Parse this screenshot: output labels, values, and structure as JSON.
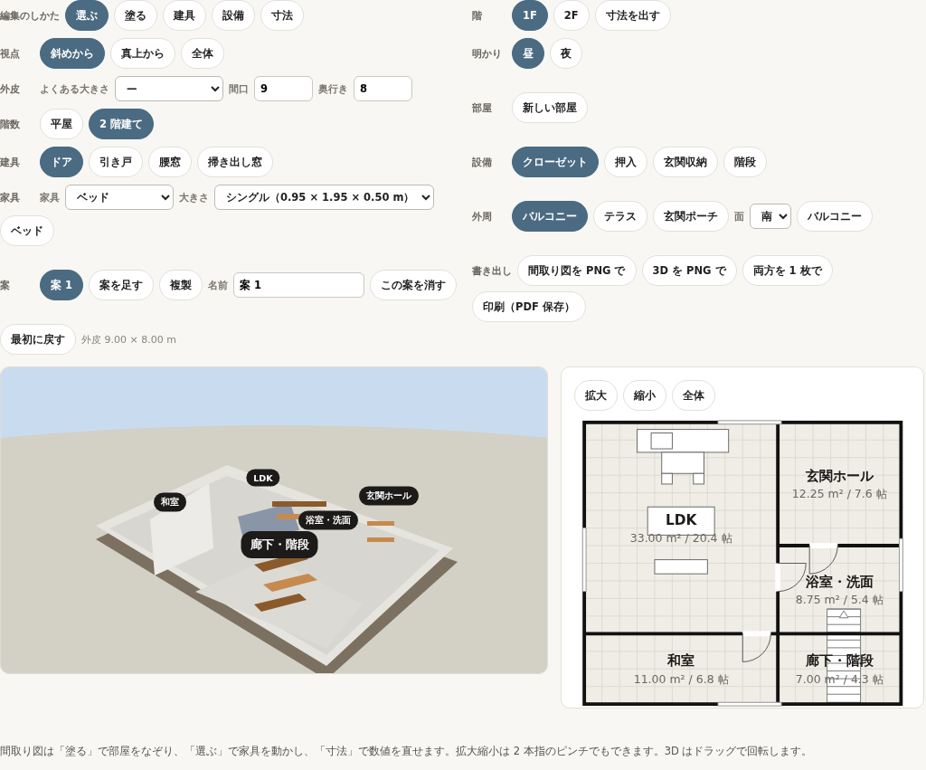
{
  "left_panel": {
    "sections": [
      {
        "rows": [
          {
            "label": "編集のしかた",
            "items": [
              {
                "kind": "toggle",
                "label": "選ぶ",
                "selected": true
              },
              {
                "kind": "toggle",
                "label": "塗る",
                "selected": false
              },
              {
                "kind": "toggle",
                "label": "建具",
                "selected": false
              },
              {
                "kind": "toggle",
                "label": "設備",
                "selected": false
              },
              {
                "kind": "toggle",
                "label": "寸法",
                "selected": false
              }
            ]
          },
          {
            "label": "視点",
            "items": [
              {
                "kind": "toggle",
                "label": "斜めから",
                "selected": true
              },
              {
                "kind": "toggle",
                "label": "真上から",
                "selected": false
              },
              {
                "kind": "action",
                "label": "全体"
              }
            ]
          },
          {
            "label": "外皮",
            "items": [
              {
                "kind": "caption",
                "text": "よくある大きさ"
              },
              {
                "kind": "select",
                "value": "—"
              },
              {
                "kind": "caption",
                "text": "間口"
              },
              {
                "kind": "number_field",
                "value": "9"
              },
              {
                "kind": "caption",
                "text": "奥行き"
              },
              {
                "kind": "number_field",
                "value": "8"
              }
            ]
          },
          {
            "label": "階数",
            "items": [
              {
                "kind": "toggle",
                "label": "平屋",
                "selected": false
              },
              {
                "kind": "toggle",
                "label": "2 階建て",
                "selected": true
              }
            ]
          },
          {
            "label": "建具",
            "items": [
              {
                "kind": "toggle",
                "label": "ドア",
                "selected": true
              },
              {
                "kind": "toggle",
                "label": "引き戸",
                "selected": false
              },
              {
                "kind": "toggle",
                "label": "腰窓",
                "selected": false
              },
              {
                "kind": "toggle",
                "label": "掃き出し窓",
                "selected": false
              }
            ]
          },
          {
            "label": "家具",
            "items": [
              {
                "kind": "caption",
                "text": "家具"
              },
              {
                "kind": "select",
                "value": "ベッド"
              },
              {
                "kind": "caption",
                "text": "大きさ"
              },
              {
                "kind": "select",
                "value": "シングル（0.95 × 1.95 × 0.50 m）"
              },
              {
                "kind": "action",
                "label": "ベッド"
              }
            ]
          }
        ]
      },
      {
        "rows": [
          {
            "label": "案",
            "items": [
              {
                "kind": "toggle",
                "label": "案 1",
                "selected": true
              },
              {
                "kind": "action",
                "label": "案を足す"
              },
              {
                "kind": "action",
                "label": "複製"
              },
              {
                "kind": "caption",
                "text": "名前"
              },
              {
                "kind": "text_field",
                "value": "案 1"
              },
              {
                "kind": "action",
                "label": "この案を消す"
              }
            ]
          }
        ]
      },
      {
        "rows": [
          {
            "items": [
              {
                "kind": "action",
                "label": "最初に戻す"
              },
              {
                "kind": "note",
                "text": "外皮 9.00 × 8.00 m"
              }
            ]
          }
        ]
      }
    ]
  },
  "right_panel": {
    "sections": [
      {
        "rows": [
          {
            "label": "階",
            "items": [
              {
                "kind": "toggle",
                "label": "1F",
                "selected": true
              },
              {
                "kind": "toggle",
                "label": "2F",
                "selected": false
              },
              {
                "kind": "action",
                "label": "寸法を出す"
              }
            ]
          },
          {
            "label": "明かり",
            "items": [
              {
                "kind": "toggle",
                "label": "昼",
                "selected": true
              },
              {
                "kind": "toggle",
                "label": "夜",
                "selected": false
              }
            ]
          }
        ]
      },
      {
        "rows": [
          {
            "label": "部屋",
            "items": [
              {
                "kind": "action",
                "label": "新しい部屋"
              }
            ]
          }
        ]
      },
      {
        "rows": [
          {
            "label": "設備",
            "items": [
              {
                "kind": "toggle",
                "label": "クローゼット",
                "selected": true
              },
              {
                "kind": "toggle",
                "label": "押入",
                "selected": false
              },
              {
                "kind": "toggle",
                "label": "玄関収納",
                "selected": false
              },
              {
                "kind": "toggle",
                "label": "階段",
                "selected": false
              }
            ]
          }
        ]
      },
      {
        "rows": [
          {
            "label": "外周",
            "items": [
              {
                "kind": "toggle",
                "label": "バルコニー",
                "selected": true
              },
              {
                "kind": "toggle",
                "label": "テラス",
                "selected": false
              },
              {
                "kind": "toggle",
                "label": "玄関ポーチ",
                "selected": false
              },
              {
                "kind": "caption",
                "text": "面"
              },
              {
                "kind": "small_select",
                "value": "南"
              },
              {
                "kind": "action",
                "label": "バルコニー"
              }
            ]
          }
        ]
      },
      {
        "rows": [
          {
            "label": "書き出し",
            "items": [
              {
                "kind": "action",
                "label": "間取り図を PNG で"
              },
              {
                "kind": "action",
                "label": "3D を PNG で"
              },
              {
                "kind": "action",
                "label": "両方を 1 枚で"
              },
              {
                "kind": "action",
                "label": "印刷（PDF 保存）"
              }
            ]
          }
        ]
      }
    ]
  },
  "view_3d": {
    "labels": [
      "和室",
      "LDK",
      "玄関ホール",
      "浴室・洗面",
      "廊下・階段"
    ]
  },
  "floor_plan": {
    "buttons": [
      "拡大",
      "縮小",
      "全体"
    ],
    "rooms": [
      {
        "name": "玄関ホール",
        "area": "12.25 m² / 7.6 帖"
      },
      {
        "name": "LDK",
        "area": "33.00 m² / 20.4 帖"
      },
      {
        "name": "浴室・洗面",
        "area": "8.75 m² / 5.4 帖"
      },
      {
        "name": "和室",
        "area": "11.00 m² / 6.8 帖"
      },
      {
        "name": "廊下・階段",
        "area": "7.00 m² / 4.3 帖"
      }
    ]
  },
  "footer": {
    "note": "間取り図は「塗る」で部屋をなぞり、「選ぶ」で家具を動かし、「寸法」で数値を直せます。拡大縮小は 2 本指のピンチでもできます。3D はドラッグで回転します。"
  }
}
